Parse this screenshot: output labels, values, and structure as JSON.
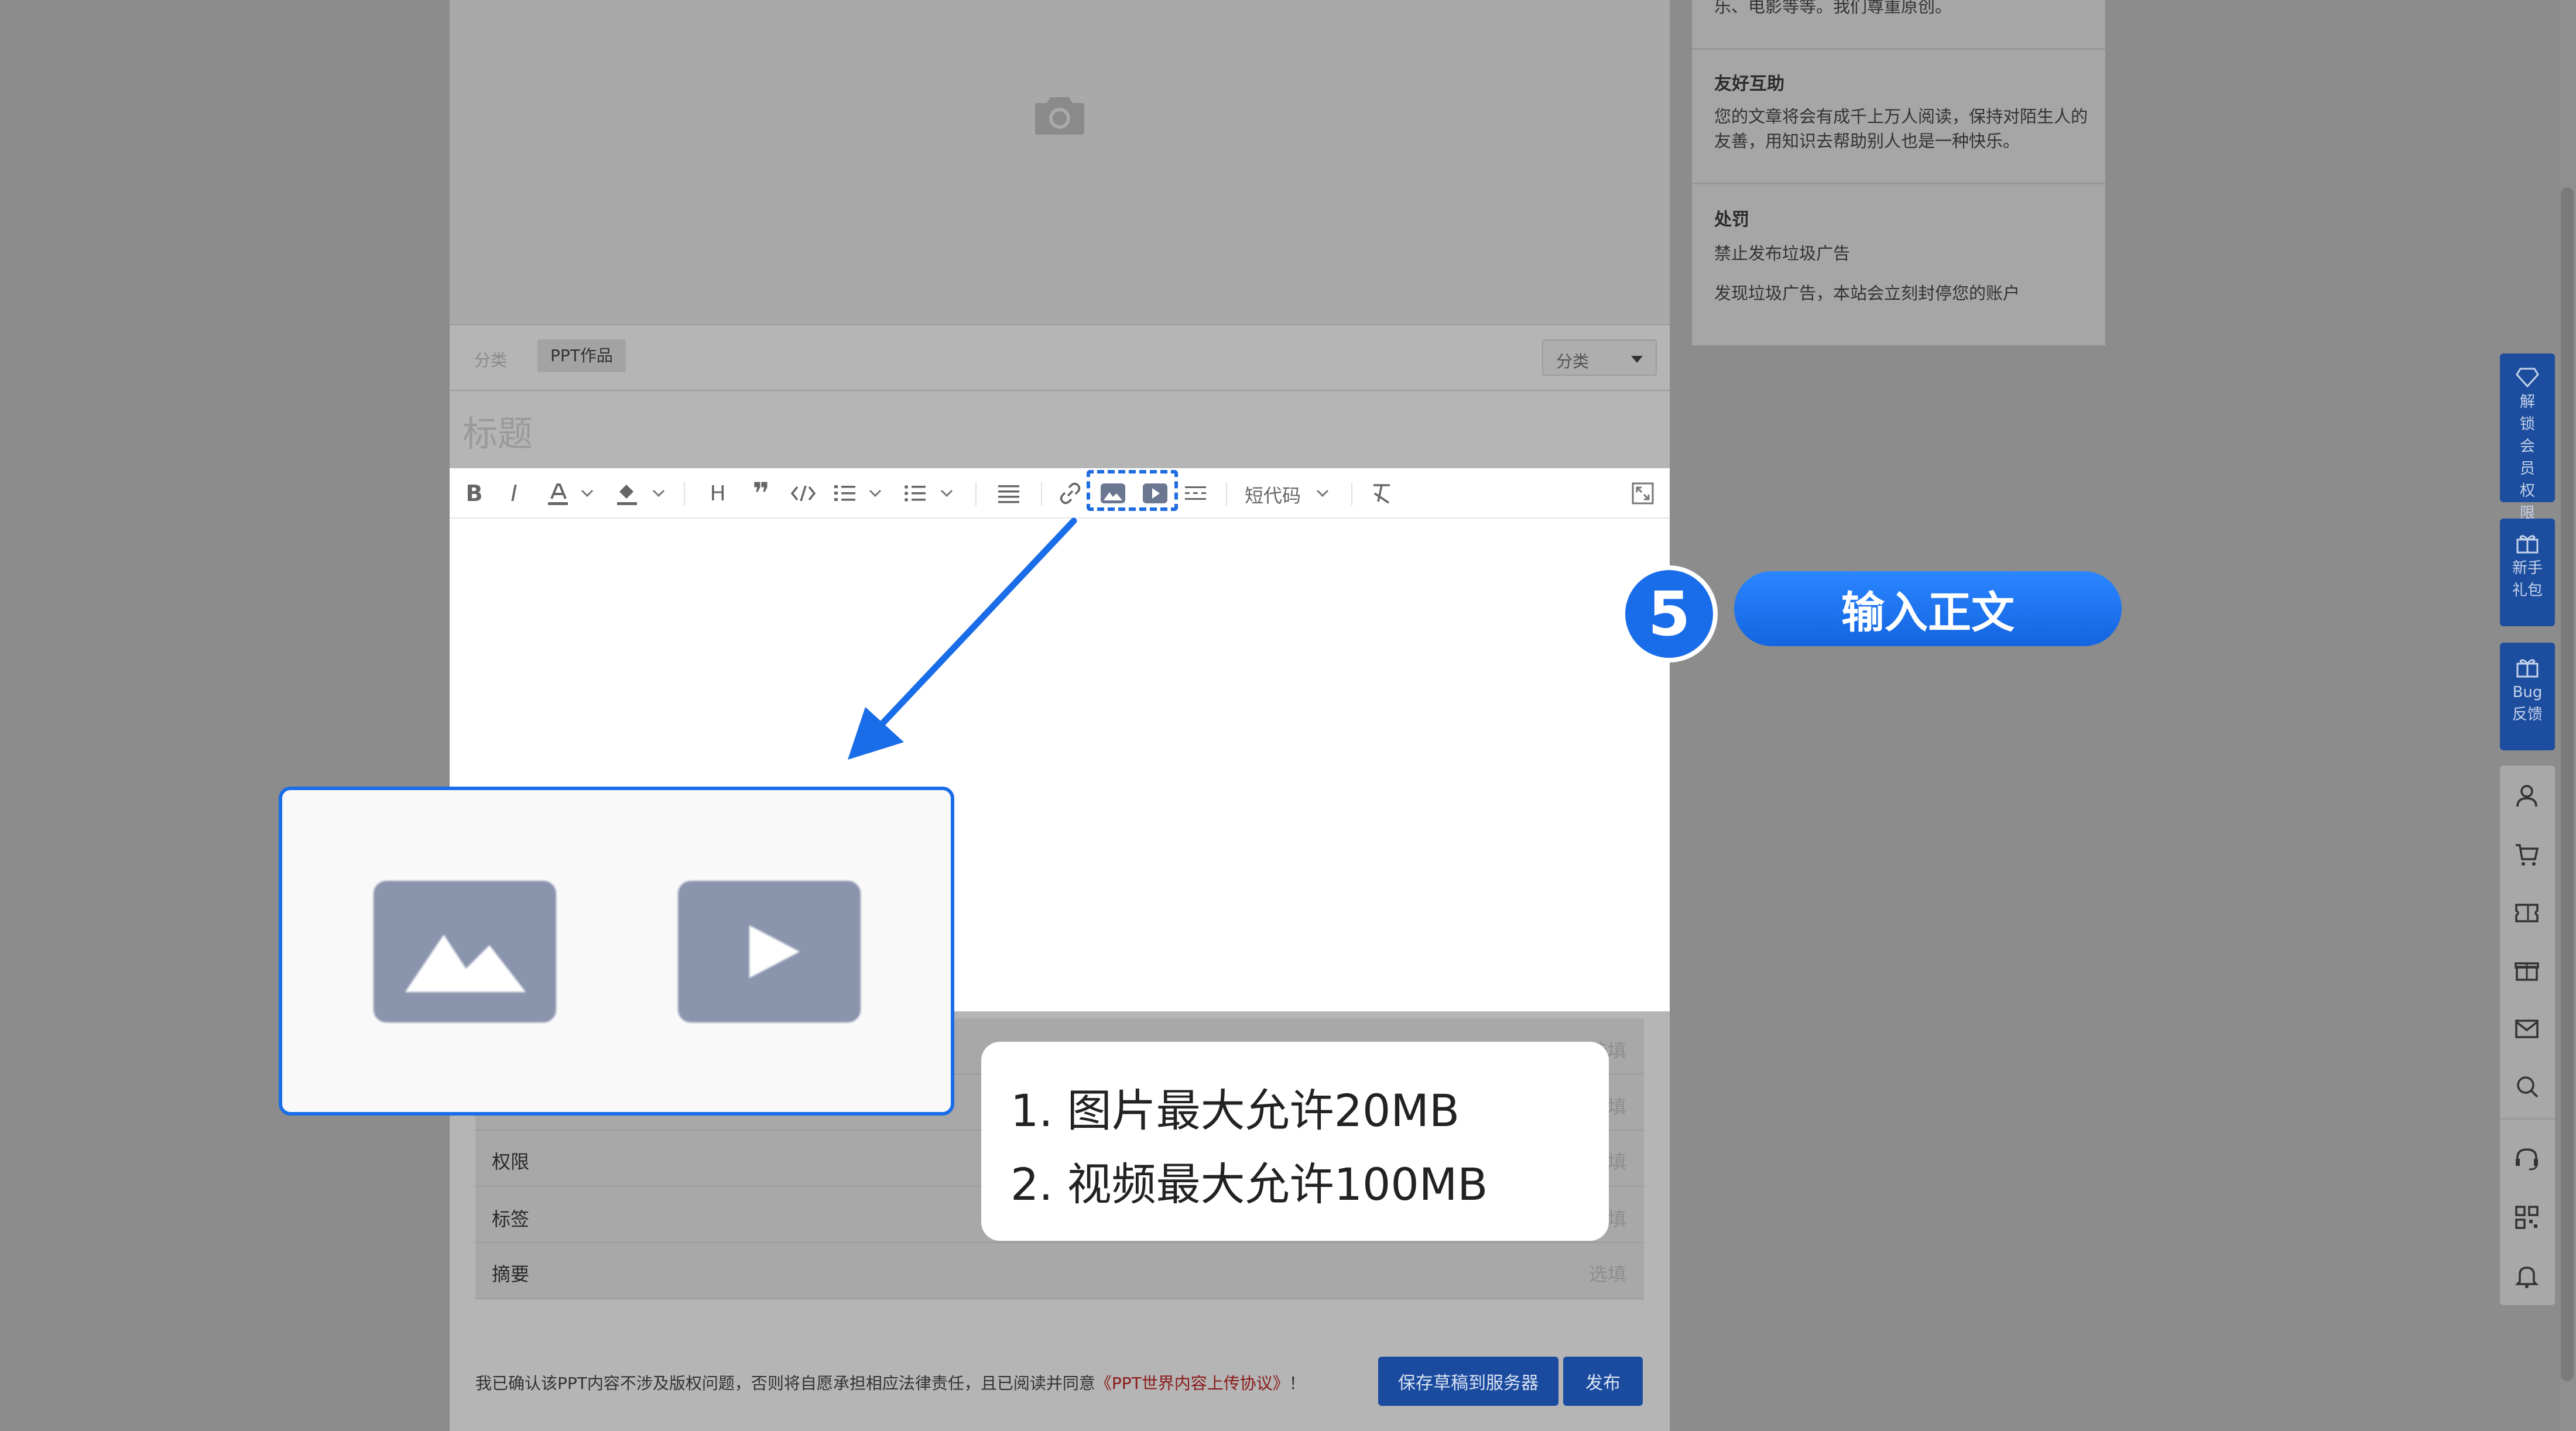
{
  "colors": {
    "accent": "#1a6de8",
    "overlay_dim": "#8c8c8c"
  },
  "cover": {
    "icon": "camera-icon"
  },
  "category": {
    "label": "分类",
    "chip": "PPT作品",
    "select_value": "分类"
  },
  "title": {
    "placeholder": "标题"
  },
  "toolbar": {
    "shortcode_label": "短代码"
  },
  "form": {
    "rows": [
      {
        "label": "",
        "hint": "选填"
      },
      {
        "label": "",
        "hint": "选填"
      },
      {
        "label": "权限",
        "hint": "选填"
      },
      {
        "label": "标签",
        "hint": "选填"
      },
      {
        "label": "摘要",
        "hint": "选填"
      }
    ]
  },
  "footer": {
    "notice": "我已确认该PPT内容不涉及版权问题，否则将自愿承担相应法律责任，且已阅读并同意",
    "agreement_link": "《PPT世界内容上传协议》",
    "notice_end": "！",
    "save_button": "保存草稿到服务器",
    "publish_button": "发布"
  },
  "rules": {
    "top_fragment": "乐、电影等等。我们尊重原创。",
    "section1_title": "友好互助",
    "section1_text": "您的文章将会有成千上万人阅读，保持对陌生人的友善，用知识去帮助别人也是一种快乐。",
    "section2_title": "处罚",
    "section2_line1": "禁止发布垃圾广告",
    "section2_line2": "发现垃圾广告，本站会立刻封停您的账户"
  },
  "rail": {
    "vip": "解锁会员权限",
    "newbie": "新手礼包",
    "bug": "Bug反馈"
  },
  "step": {
    "number": "5",
    "label": "输入正文"
  },
  "info": {
    "line1": "1.  图片最大允许20MB",
    "line2": "2.  视频最大允许100MB"
  }
}
